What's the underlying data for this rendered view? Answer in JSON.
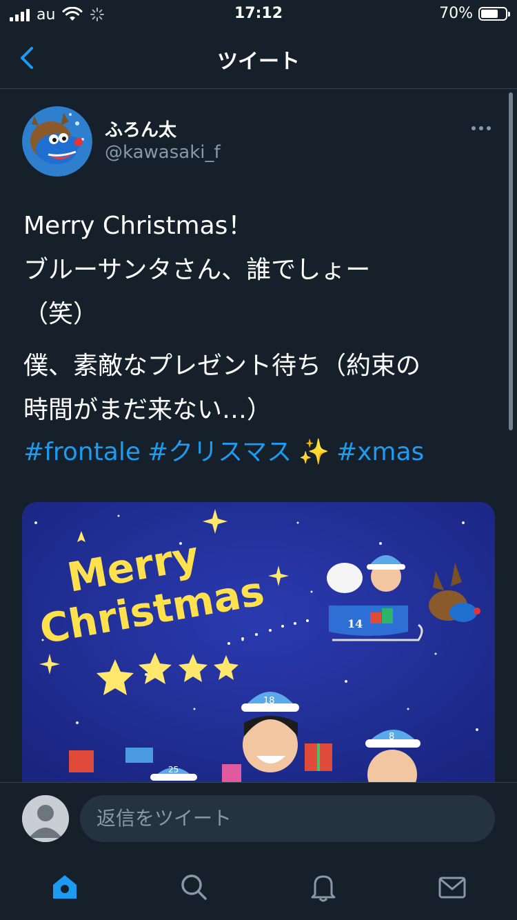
{
  "status_bar": {
    "carrier": "au",
    "time": "17:12",
    "battery_percent": "70%",
    "battery_level": 0.7
  },
  "header": {
    "back_icon": "chevron-left-icon",
    "title": "ツイート"
  },
  "tweet": {
    "author": {
      "display_name": "ふろん太",
      "handle": "@kawasaki_f"
    },
    "more_icon": "more-horizontal-icon",
    "text_lines_1": [
      "Merry Christmas！",
      "ブルーサンタさん、誰でしょー",
      "（笑）"
    ],
    "text_lines_2": [
      "僕、素敵なプレゼント待ち（約束の",
      "時間がまだ来ない…）"
    ],
    "hashtags": [
      "#frontale",
      "#クリスマス",
      "#xmas"
    ],
    "sparkle_emoji": "✨",
    "media": {
      "text": [
        "Merry",
        "Christmas"
      ],
      "sleigh_number": "14",
      "hat_numbers": [
        "18",
        "8",
        "25"
      ]
    }
  },
  "reply": {
    "placeholder": "返信をツイート"
  },
  "tabs": [
    {
      "name": "home",
      "icon": "home-icon",
      "active": true
    },
    {
      "name": "search",
      "icon": "search-icon",
      "active": false
    },
    {
      "name": "notifications",
      "icon": "bell-icon",
      "active": false
    },
    {
      "name": "messages",
      "icon": "mail-icon",
      "active": false
    }
  ],
  "colors": {
    "background": "#15202b",
    "accent": "#1d9bf0",
    "secondary_text": "#8899a6",
    "divider": "#38444d"
  }
}
